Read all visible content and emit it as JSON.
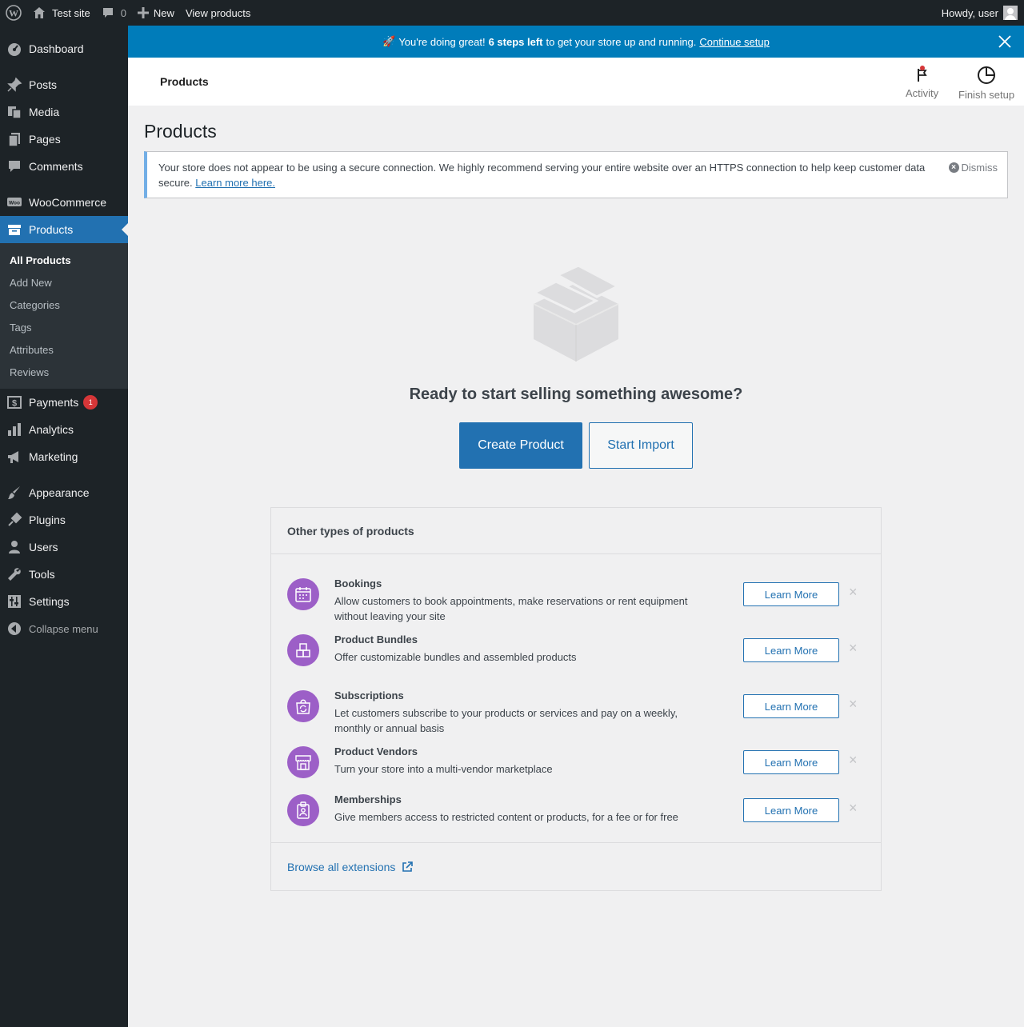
{
  "adminbar": {
    "site_name": "Test site",
    "comments_count": "0",
    "new_label": "New",
    "view_label": "View products",
    "howdy": "Howdy, user"
  },
  "sidebar": {
    "dashboard": "Dashboard",
    "posts": "Posts",
    "media": "Media",
    "pages": "Pages",
    "comments": "Comments",
    "woocommerce": "WooCommerce",
    "products": "Products",
    "submenu": [
      "All Products",
      "Add New",
      "Categories",
      "Tags",
      "Attributes",
      "Reviews"
    ],
    "payments": "Payments",
    "payments_badge": "1",
    "analytics": "Analytics",
    "marketing": "Marketing",
    "appearance": "Appearance",
    "plugins": "Plugins",
    "users": "Users",
    "tools": "Tools",
    "settings": "Settings",
    "collapse": "Collapse menu"
  },
  "banner": {
    "emoji": "🚀",
    "pre": "You're doing great!",
    "bold": "6 steps left",
    "post": "to get your store up and running.",
    "link": "Continue setup"
  },
  "header": {
    "title": "Products",
    "activity": "Activity",
    "finish_setup": "Finish setup"
  },
  "page": {
    "title": "Products",
    "notice_text": "Your store does not appear to be using a secure connection. We highly recommend serving your entire website over an HTTPS connection to help keep customer data secure.",
    "notice_link": "Learn more here.",
    "dismiss": "Dismiss",
    "ready": "Ready to start selling something awesome?",
    "create": "Create Product",
    "import": "Start Import"
  },
  "other_products": {
    "heading": "Other types of products",
    "items": [
      {
        "name": "Bookings",
        "desc": "Allow customers to book appointments, make reservations or rent equipment without leaving your site",
        "button": "Learn More",
        "icon": "calendar-icon"
      },
      {
        "name": "Product Bundles",
        "desc": "Offer customizable bundles and assembled products",
        "button": "Learn More",
        "icon": "bundle-icon"
      },
      {
        "name": "Subscriptions",
        "desc": "Let customers subscribe to your products or services and pay on a weekly, monthly or annual basis",
        "button": "Learn More",
        "icon": "subscription-bag-icon"
      },
      {
        "name": "Product Vendors",
        "desc": "Turn your store into a multi-vendor marketplace",
        "button": "Learn More",
        "icon": "storefront-icon"
      },
      {
        "name": "Memberships",
        "desc": "Give members access to restricted content or products, for a fee or for free",
        "button": "Learn More",
        "icon": "member-badge-icon"
      }
    ],
    "browse": "Browse all extensions"
  },
  "colors": {
    "accent": "#2271b1",
    "banner": "#007cba",
    "sidebar": "#1d2327",
    "ext_icon": "#9c5fc7",
    "badge": "#d63638"
  }
}
